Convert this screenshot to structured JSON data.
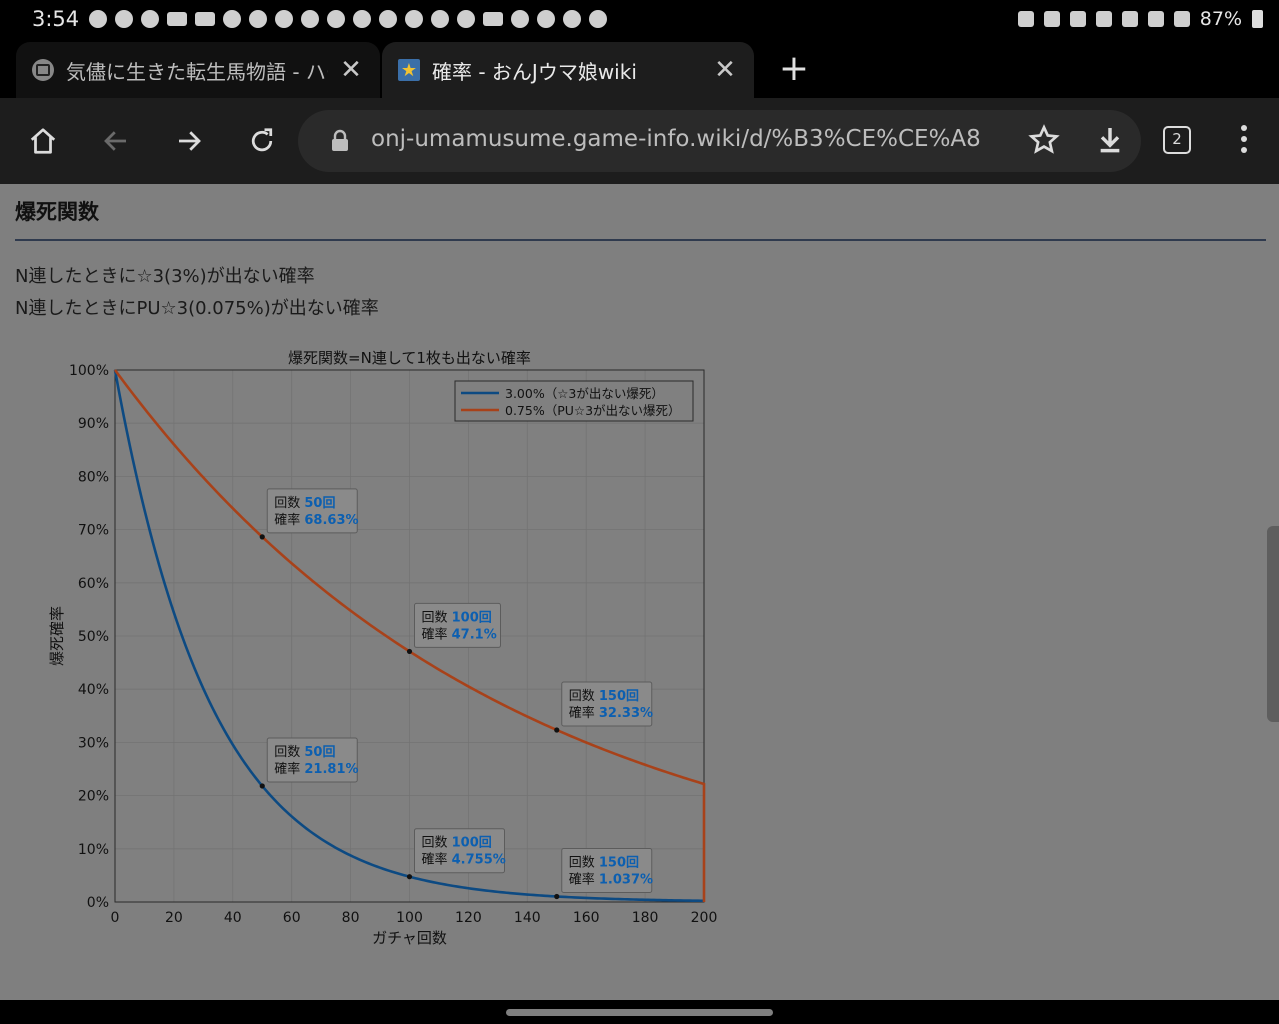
{
  "statusbar": {
    "time": "3:54",
    "battery": "87%"
  },
  "tabs": [
    {
      "title": "気儘に生きた転生馬物語 - ハー",
      "close": "✕"
    },
    {
      "title": "確率 - おんJウマ娘wiki",
      "close": "✕"
    }
  ],
  "new_tab": "+",
  "toolbar": {
    "url": "onj-umamusume.game-info.wiki/d/%B3%CE%CE%A8",
    "tab_count": "2"
  },
  "page": {
    "heading": "爆死関数",
    "line1": "N連したときに☆3(3%)が出ない確率",
    "line2": "N連したときにPU☆3(0.075%)が出ない確率"
  },
  "chart_data": {
    "type": "line",
    "title": "爆死関数=N連して1枚も出ない確率",
    "xlabel": "ガチャ回数",
    "ylabel": "爆死確率",
    "xlim": [
      0,
      200
    ],
    "ylim": [
      0,
      100
    ],
    "xticks": [
      "0",
      "20",
      "40",
      "60",
      "80",
      "100",
      "120",
      "140",
      "160",
      "180",
      "200"
    ],
    "yticks": [
      "0%",
      "10%",
      "20%",
      "30%",
      "40%",
      "50%",
      "60%",
      "70%",
      "80%",
      "90%",
      "100%"
    ],
    "grid": true,
    "legend_position": "top-right",
    "series": [
      {
        "name": "3.00%（☆3が出ない爆死）",
        "rate": 0.03,
        "color": "#0d4a82",
        "x_end": 200
      },
      {
        "name": "0.75%（PU☆3が出ない爆死）",
        "rate": 0.0075,
        "color": "#a8421a",
        "x_end": 200,
        "drop_to_zero_at": 200
      }
    ],
    "datatips": [
      {
        "series": 1,
        "x_label": "回数",
        "x": "50回",
        "y_label": "確率",
        "y": "68.63%",
        "xv": 50,
        "yv": 68.63
      },
      {
        "series": 1,
        "x_label": "回数",
        "x": "100回",
        "y_label": "確率",
        "y": "47.1%",
        "xv": 100,
        "yv": 47.1
      },
      {
        "series": 1,
        "x_label": "回数",
        "x": "150回",
        "y_label": "確率",
        "y": "32.33%",
        "xv": 150,
        "yv": 32.33
      },
      {
        "series": 0,
        "x_label": "回数",
        "x": "50回",
        "y_label": "確率",
        "y": "21.81%",
        "xv": 50,
        "yv": 21.81
      },
      {
        "series": 0,
        "x_label": "回数",
        "x": "100回",
        "y_label": "確率",
        "y": "4.755%",
        "xv": 100,
        "yv": 4.755
      },
      {
        "series": 0,
        "x_label": "回数",
        "x": "150回",
        "y_label": "確率",
        "y": "1.037%",
        "xv": 150,
        "yv": 1.037
      }
    ]
  }
}
